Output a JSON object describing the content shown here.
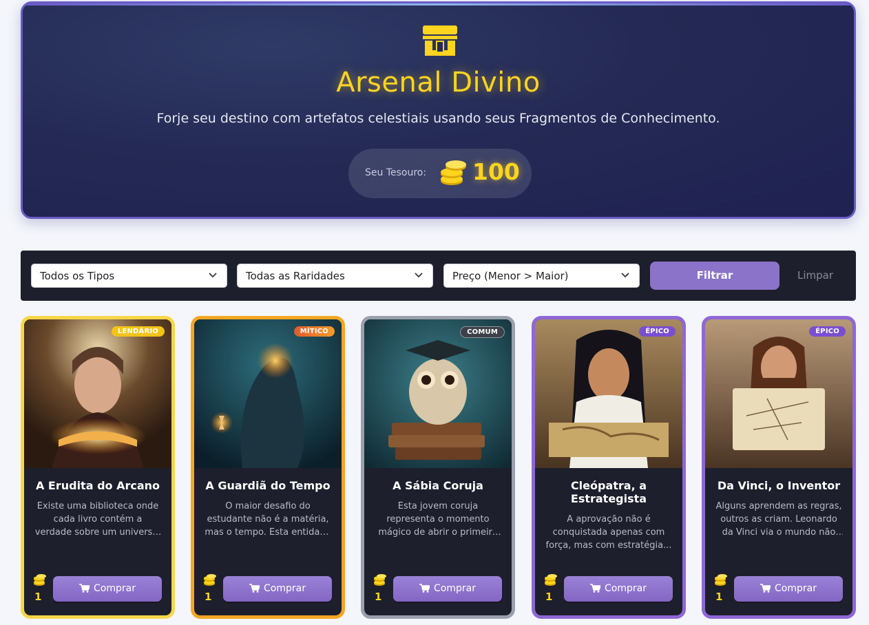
{
  "header": {
    "title": "Arsenal Divino",
    "subtitle": "Forje seu destino com artefatos celestiais usando seus Fragmentos de Conhecimento.",
    "treasure_label": "Seu Tesouro:",
    "treasure_value": "100",
    "icon": "shop-icon"
  },
  "filters": {
    "type_select": "Todos os Tipos",
    "rarity_select": "Todas as Raridades",
    "sort_select": "Preço (Menor > Maior)",
    "filter_button": "Filtrar",
    "clear_button": "Limpar"
  },
  "cards": [
    {
      "title": "A Erudita do Arcano",
      "rarity": "LENDÁRIO",
      "description": "Existe uma biblioteca onde cada livro contém a verdade sobre um universo. Esta guardiã percorre seus corredores...",
      "price": "1",
      "buy_label": "Comprar"
    },
    {
      "title": "A Guardiã do Tempo",
      "rarity": "MÍTICO",
      "description": "O maior desafio do estudante não é a matéria, mas o tempo. Esta entidade domina cada segundo...",
      "price": "1",
      "buy_label": "Comprar"
    },
    {
      "title": "A Sábia Coruja",
      "rarity": "COMUM",
      "description": "Esta jovem coruja representa o momento mágico de abrir o primeiro livro...",
      "price": "1",
      "buy_label": "Comprar"
    },
    {
      "title": "Cleópatra, a Estrategista",
      "rarity": "ÉPICO",
      "description": "A aprovação não é conquistada apenas com força, mas com estratégia...",
      "price": "1",
      "buy_label": "Comprar"
    },
    {
      "title": "Da Vinci, o Inventor",
      "rarity": "ÉPICO",
      "description": "Alguns aprendem as regras, outros as criam. Leonardo da Vinci via o mundo não como ele era...",
      "price": "1",
      "buy_label": "Comprar"
    }
  ],
  "colors": {
    "accent_gold": "#ffd41f",
    "button_purple": "#8b73c9",
    "legendary": "#f7d64a",
    "mythic": "#f5a623",
    "common": "#9aa0ab",
    "epic": "#8f67d6"
  }
}
